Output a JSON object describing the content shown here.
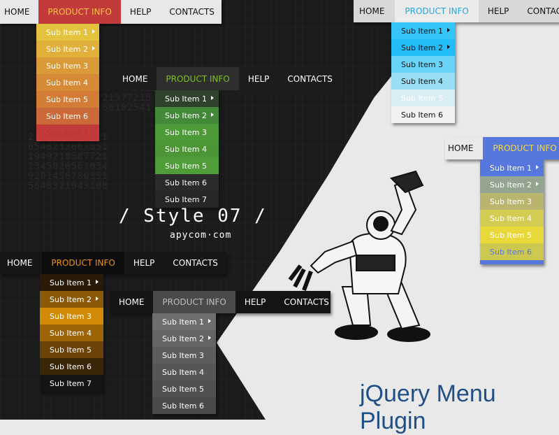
{
  "menus": {
    "red": {
      "items": [
        "HOME",
        "PRODUCT INFO",
        "HELP",
        "CONTACTS"
      ],
      "active": 1,
      "colors": {
        "bar": "#e8e8e8",
        "text": "#111111",
        "active_bg": "#c23b3a",
        "active_text": "#f3c640"
      },
      "sub": [
        {
          "label": "Sub Item 1",
          "bg": "#e3c23d",
          "text": "#ffffff",
          "arrow": true
        },
        {
          "label": "Sub Item 2",
          "bg": "#e0b03a",
          "text": "#ffffff",
          "arrow": true
        },
        {
          "label": "Sub Item 3",
          "bg": "#da9a37",
          "text": "#ffffff",
          "arrow": false
        },
        {
          "label": "Sub Item 4",
          "bg": "#d68a36",
          "text": "#ffffff",
          "arrow": false
        },
        {
          "label": "Sub Item 5",
          "bg": "#d27c36",
          "text": "#ffffff",
          "arrow": false
        },
        {
          "label": "Sub Item 6",
          "bg": "#cc6938",
          "text": "#ffffff",
          "arrow": false
        },
        {
          "label": "Sub Item 7",
          "bg": "#c23b3a",
          "text": "#b53434",
          "arrow": false
        }
      ]
    },
    "blue": {
      "items": [
        "HOME",
        "PRODUCT INFO",
        "HELP",
        "CONTACTS"
      ],
      "active": 1,
      "colors": {
        "bar": "#d8d8d8",
        "text": "#111111",
        "active_bg": "#ececec",
        "active_text": "#2aa3dd"
      },
      "sub": [
        {
          "label": "Sub Item 1",
          "bg": "#35c4f6",
          "text": "#111111",
          "arrow": true
        },
        {
          "label": "Sub Item 2",
          "bg": "#22bcf8",
          "text": "#111111",
          "arrow": true
        },
        {
          "label": "Sub Item 3",
          "bg": "#68d4f8",
          "text": "#111111",
          "arrow": false
        },
        {
          "label": "Sub Item 4",
          "bg": "#98def6",
          "text": "#111111",
          "arrow": false
        },
        {
          "label": "Sub Item 5",
          "bg": "#d9edf4",
          "text": "#ffffff",
          "arrow": false
        },
        {
          "label": "Sub Item 6",
          "bg": "#f2f2f2",
          "text": "#111111",
          "arrow": false
        }
      ]
    },
    "green": {
      "items": [
        "HOME",
        "PRODUCT INFO",
        "HELP",
        "CONTACTS"
      ],
      "active": 1,
      "colors": {
        "bar": "#1c1c1c",
        "text": "#ffffff",
        "active_bg": "#2e2e2e",
        "active_text": "#7ec01e"
      },
      "sub": [
        {
          "label": "Sub Item 1",
          "bg": "#2f432c",
          "text": "#ffffff",
          "arrow": true
        },
        {
          "label": "Sub Item 2",
          "bg": "#44893a",
          "text": "#ffffff",
          "arrow": true
        },
        {
          "label": "Sub Item 3",
          "bg": "#4e9a38",
          "text": "#ffffff",
          "arrow": false
        },
        {
          "label": "Sub Item 4",
          "bg": "#4d9637",
          "text": "#ffffff",
          "arrow": false
        },
        {
          "label": "Sub Item 5",
          "bg": "#509c39",
          "text": "#ffffff",
          "arrow": false
        },
        {
          "label": "Sub Item 6",
          "bg": "#2a2a2a",
          "text": "#ffffff",
          "arrow": false
        },
        {
          "label": "Sub Item 7",
          "bg": "#262626",
          "text": "#ffffff",
          "arrow": false
        }
      ]
    },
    "violet": {
      "items": [
        "HOME",
        "PRODUCT INFO"
      ],
      "active": 1,
      "colors": {
        "bar": "#eaeaea",
        "text": "#111111",
        "active_bg": "#5678de",
        "active_text": "#f0d84a"
      },
      "sub": [
        {
          "label": "Sub Item 1",
          "bg": "#5678de",
          "text": "#ffffff",
          "arrow": true
        },
        {
          "label": "Sub Item 2",
          "bg": "#93a58e",
          "text": "#ffffff",
          "arrow": true
        },
        {
          "label": "Sub Item 3",
          "bg": "#b9b56e",
          "text": "#ffffff",
          "arrow": false
        },
        {
          "label": "Sub Item 4",
          "bg": "#d3cb52",
          "text": "#ffffff",
          "arrow": false
        },
        {
          "label": "Sub Item 5",
          "bg": "#e8d83a",
          "text": "#ffffff",
          "arrow": false
        },
        {
          "label": "Sub Item 6",
          "bg": "#cdc850",
          "text": "#5678de",
          "arrow": false
        }
      ]
    },
    "orange": {
      "items": [
        "HOME",
        "PRODUCT INFO",
        "HELP",
        "CONTACTS"
      ],
      "active": 1,
      "colors": {
        "bar": "#161616",
        "text": "#ffffff",
        "active_bg": "#0c0c0c",
        "active_text": "#e8920e"
      },
      "sub": [
        {
          "label": "Sub Item 1",
          "bg": "#2a1a08",
          "text": "#ffffff",
          "arrow": true
        },
        {
          "label": "Sub Item 2",
          "bg": "#8a5a08",
          "text": "#ffffff",
          "arrow": true
        },
        {
          "label": "Sub Item 3",
          "bg": "#d08a06",
          "text": "#ffffff",
          "arrow": false
        },
        {
          "label": "Sub Item 4",
          "bg": "#9e6405",
          "text": "#ffffff",
          "arrow": false
        },
        {
          "label": "Sub Item 5",
          "bg": "#6b4306",
          "text": "#ffffff",
          "arrow": false
        },
        {
          "label": "Sub Item 6",
          "bg": "#3a2606",
          "text": "#ffffff",
          "arrow": false
        },
        {
          "label": "Sub Item 7",
          "bg": "#141414",
          "text": "#ffffff",
          "arrow": false
        }
      ]
    },
    "gray": {
      "items": [
        "HOME",
        "PRODUCT INFO",
        "HELP",
        "CONTACTS"
      ],
      "active": 1,
      "colors": {
        "bar": "#141414",
        "text": "#ffffff",
        "active_bg": "#4a4a4a",
        "active_text": "#bdbdbd"
      },
      "sub": [
        {
          "label": "Sub Item 1",
          "bg": "#6e6e6e",
          "text": "#ffffff",
          "arrow": true
        },
        {
          "label": "Sub Item 2",
          "bg": "#646464",
          "text": "#ffffff",
          "arrow": true
        },
        {
          "label": "Sub Item 3",
          "bg": "#5c5c5c",
          "text": "#ffffff",
          "arrow": false
        },
        {
          "label": "Sub Item 4",
          "bg": "#575757",
          "text": "#ffffff",
          "arrow": false
        },
        {
          "label": "Sub Item 5",
          "bg": "#515151",
          "text": "#ffffff",
          "arrow": false
        },
        {
          "label": "Sub Item 6",
          "bg": "#4a4a4a",
          "text": "#ffffff",
          "arrow": false
        }
      ]
    }
  },
  "banner": {
    "title": "/ Style 07 /",
    "subtitle": "apycom·com",
    "plugin": "jQuery Menu Plugin"
  },
  "icons": {
    "submenu_arrow": "triangle-right-icon",
    "robot": "robot-image"
  }
}
